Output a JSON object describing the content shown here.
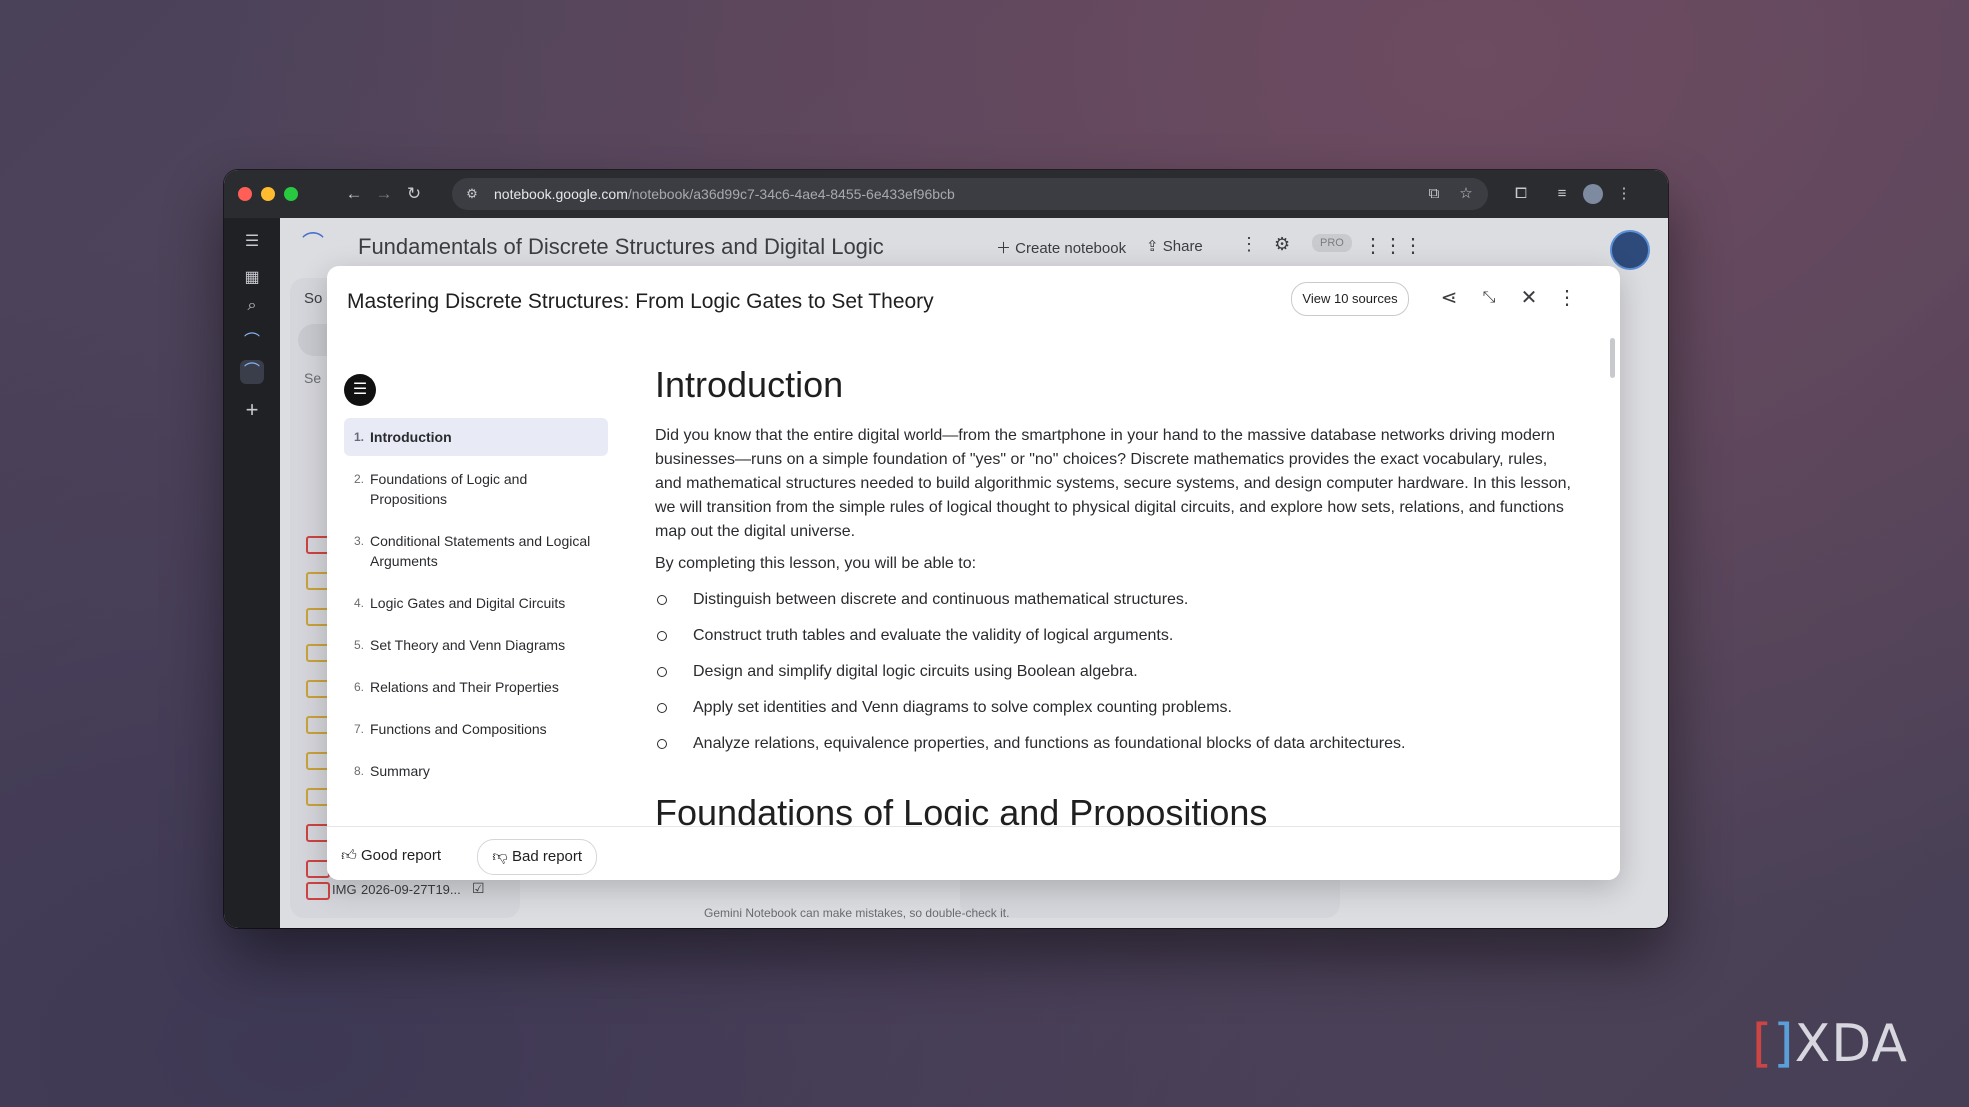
{
  "browser": {
    "url_host": "notebook.google.com",
    "url_path": "/notebook/a36d99c7-34c6-4ae4-8455-6e433ef96bcb"
  },
  "app": {
    "notebook_title": "Fundamentals of Discrete Structures and Digital Logic",
    "create_notebook_label": "Create notebook",
    "share_label": "Share",
    "pro_badge": "PRO",
    "sources_partial_label": "So",
    "search_partial": "Se",
    "bottom_source_type": "IMG",
    "bottom_source_name": "2026-09-27T19...",
    "disclaimer": "Gemini Notebook can make mistakes, so double-check it."
  },
  "report": {
    "title": "Mastering Discrete Structures: From Logic Gates to Set Theory",
    "view_sources_label": "View 10 sources",
    "toc": [
      {
        "num": "1.",
        "label": "Introduction",
        "active": true
      },
      {
        "num": "2.",
        "label": "Foundations of Logic and Propositions"
      },
      {
        "num": "3.",
        "label": "Conditional Statements and Logical Arguments"
      },
      {
        "num": "4.",
        "label": "Logic Gates and Digital Circuits"
      },
      {
        "num": "5.",
        "label": "Set Theory and Venn Diagrams"
      },
      {
        "num": "6.",
        "label": "Relations and Their Properties"
      },
      {
        "num": "7.",
        "label": "Functions and Compositions"
      },
      {
        "num": "8.",
        "label": "Summary"
      }
    ],
    "heading": "Introduction",
    "intro_paragraph": "Did you know that the entire digital world—from the smartphone in your hand to the massive database networks driving modern businesses—runs on a simple foundation of \"yes\" or \"no\" choices? Discrete mathematics provides the exact vocabulary, rules, and mathematical structures needed to build algorithmic systems, secure systems, and design computer hardware. In this lesson, we will transition from the simple rules of logical thought to physical digital circuits, and explore how sets, relations, and functions map out the digital universe.",
    "objectives_intro": "By completing this lesson, you will be able to:",
    "objectives": [
      "Distinguish between discrete and continuous mathematical structures.",
      "Construct truth tables and evaluate the validity of logical arguments.",
      "Design and simplify digital logic circuits using Boolean algebra.",
      "Apply set identities and Venn diagrams to solve complex counting problems.",
      "Analyze relations, equivalence properties, and functions as foundational blocks of data architectures."
    ],
    "next_heading": "Foundations of Logic and Propositions",
    "good_report_label": "Good report",
    "bad_report_label": "Bad report"
  },
  "watermark": {
    "brand": "XDA"
  },
  "icons": {
    "back": "arrow-left-icon",
    "forward": "arrow-right-icon",
    "reload": "reload-icon",
    "site_settings": "tune-icon",
    "install": "install-app-icon",
    "bookmark": "star-icon",
    "extensions": "puzzle-icon",
    "media": "media-controls-icon",
    "profile": "avatar",
    "menu": "kebab-icon",
    "share": "share-icon",
    "collapse": "collapse-icon",
    "close": "close-icon"
  }
}
